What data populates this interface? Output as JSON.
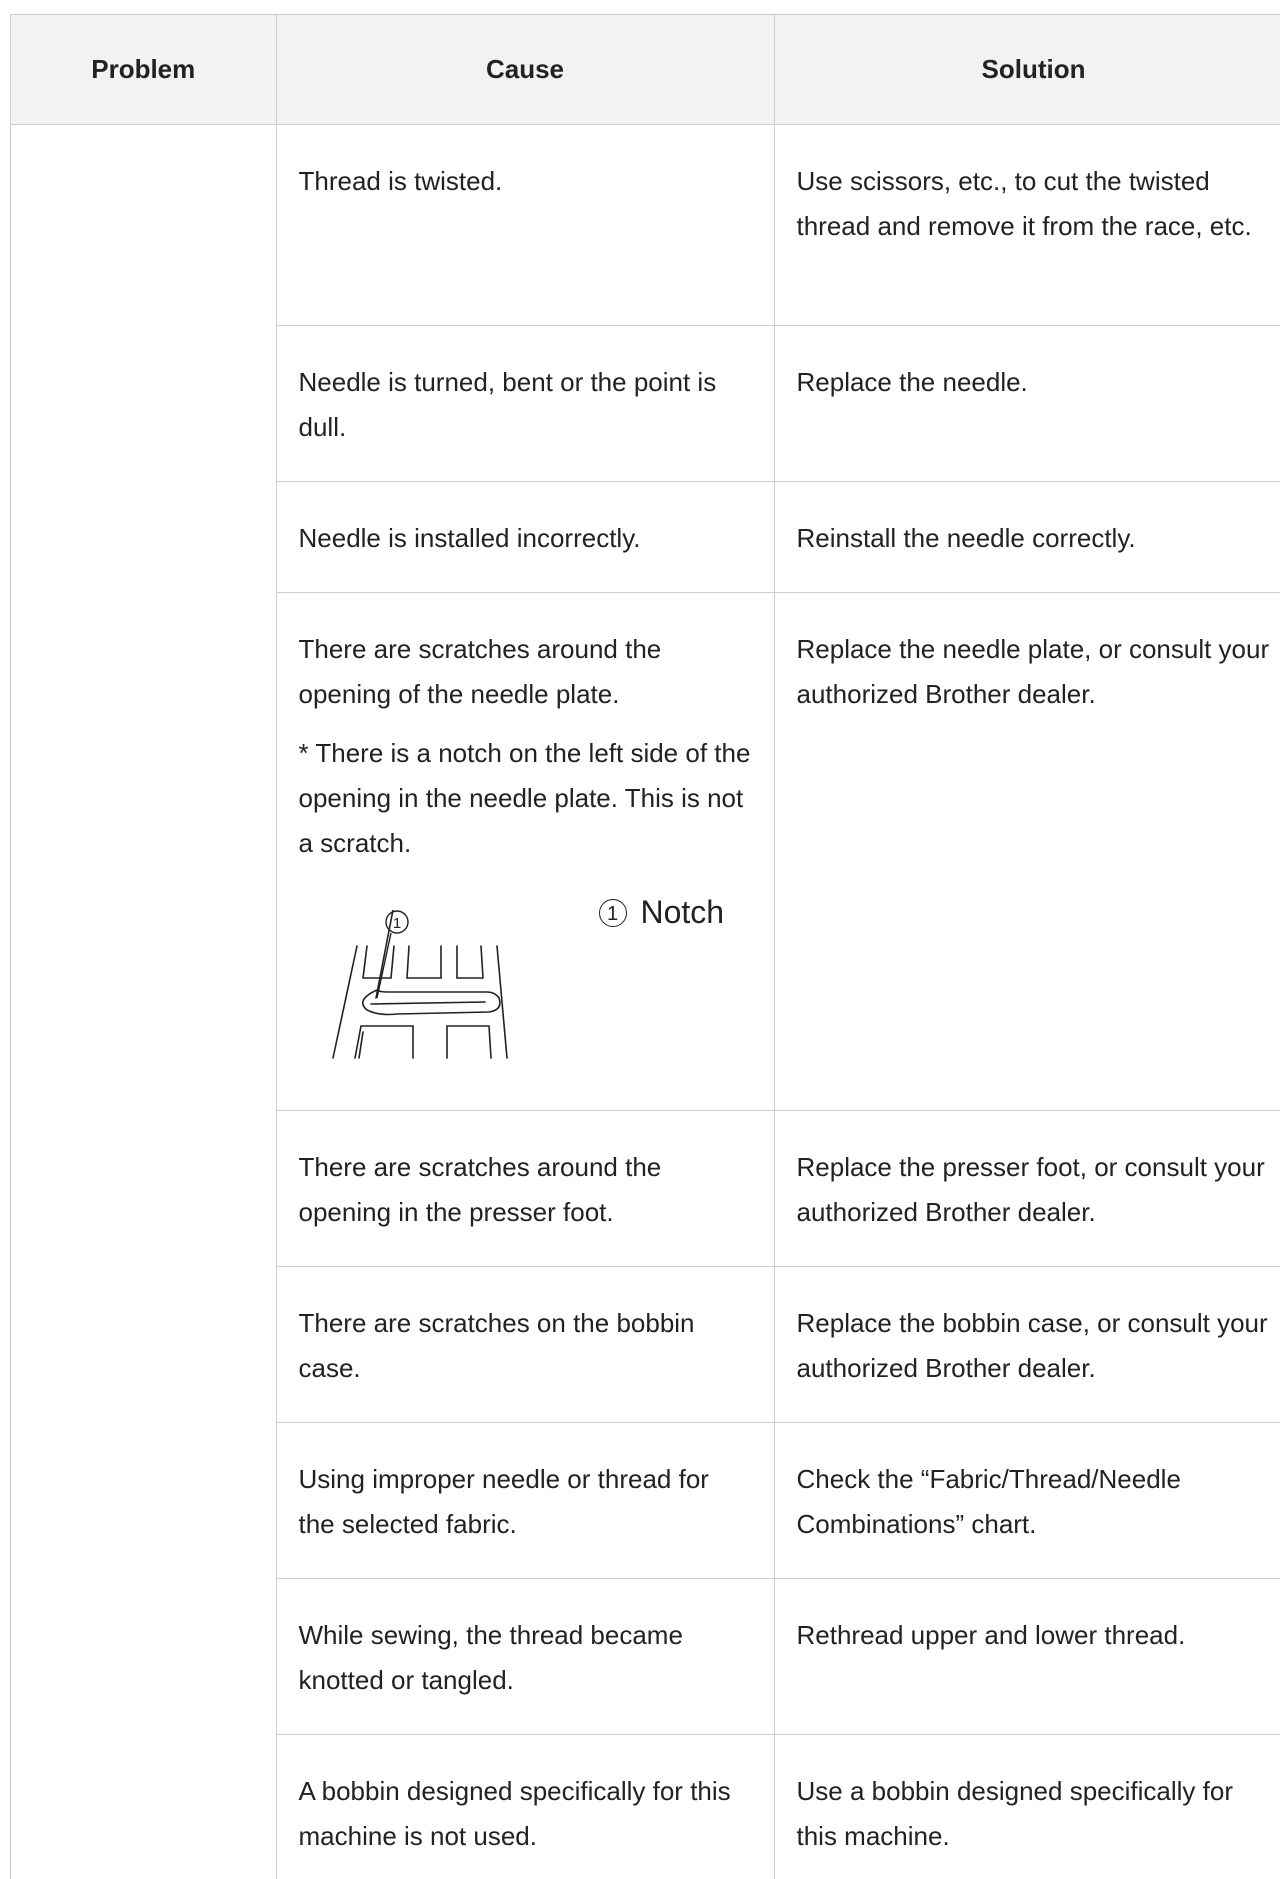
{
  "table": {
    "headers": {
      "problem": "Problem",
      "cause": "Cause",
      "solution": "Solution"
    },
    "rows": [
      {
        "cause": "Thread is twisted.",
        "solution": "Use scissors, etc., to cut the twisted thread and remove it from the race, etc."
      },
      {
        "cause": "Needle is turned, bent or the point is dull.",
        "solution": "Replace the needle."
      },
      {
        "cause": "Needle is installed incorrectly.",
        "solution": "Reinstall the needle correctly."
      },
      {
        "cause": "There are scratches around the opening of the needle plate.",
        "cause_note": "* There is a notch on the left side of the opening in the needle plate. This is not a scratch.",
        "figure": {
          "marker": "1",
          "legend_label": "Notch",
          "icon": "needle-plate-diagram"
        },
        "solution": "Replace the needle plate, or consult your authorized Brother dealer."
      },
      {
        "cause": "There are scratches around the opening in the presser foot.",
        "solution": "Replace the presser foot, or consult your authorized Brother dealer."
      },
      {
        "cause": "There are scratches on the bobbin case.",
        "solution": "Replace the bobbin case, or consult your authorized Brother dealer."
      },
      {
        "cause": "Using improper needle or thread for the selected fabric.",
        "solution": "Check the “Fabric/Thread/Needle Combinations” chart."
      },
      {
        "cause": "While sewing, the thread became knotted or tangled.",
        "solution": "Rethread upper and lower thread."
      },
      {
        "cause": "A bobbin designed specifically for this machine is not used.",
        "solution": "Use a bobbin designed specifically for this machine."
      }
    ]
  },
  "colors": {
    "border": "#cccccc",
    "header_bg": "#f2f2f2",
    "text": "#222222"
  }
}
